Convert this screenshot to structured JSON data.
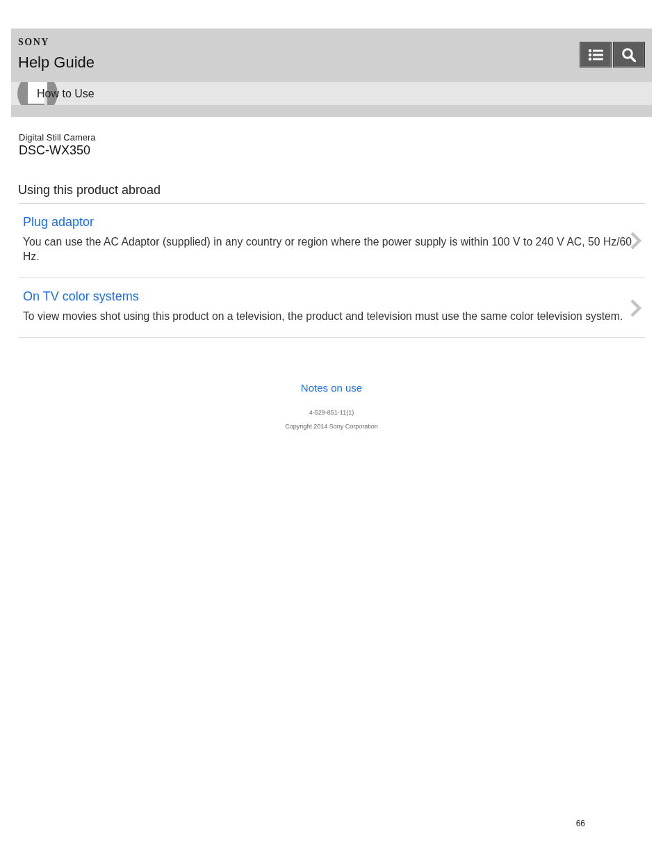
{
  "header": {
    "logo": "SONY",
    "title": "Help Guide",
    "buttons": [
      {
        "kind": "contents"
      },
      {
        "kind": "search"
      }
    ]
  },
  "breadcrumb": {
    "label": "How to Use"
  },
  "product": {
    "category": "Digital Still Camera",
    "model": "DSC-WX350"
  },
  "page_title": "Using this product abroad",
  "topics": [
    {
      "title": "Plug adaptor",
      "description": "You can use the AC Adaptor (supplied) in any country or region where the power supply is within 100 V to 240 V AC, 50 Hz/60 Hz."
    },
    {
      "title": "On TV color systems",
      "description": "To view movies shot using this product on a television, the product and television must use the same color television system."
    }
  ],
  "footer": {
    "link": "Notes on use",
    "doc_number": "4-529-851-11(1)",
    "copyright": "Copyright 2014 Sony Corporation"
  },
  "page_number": "66"
}
